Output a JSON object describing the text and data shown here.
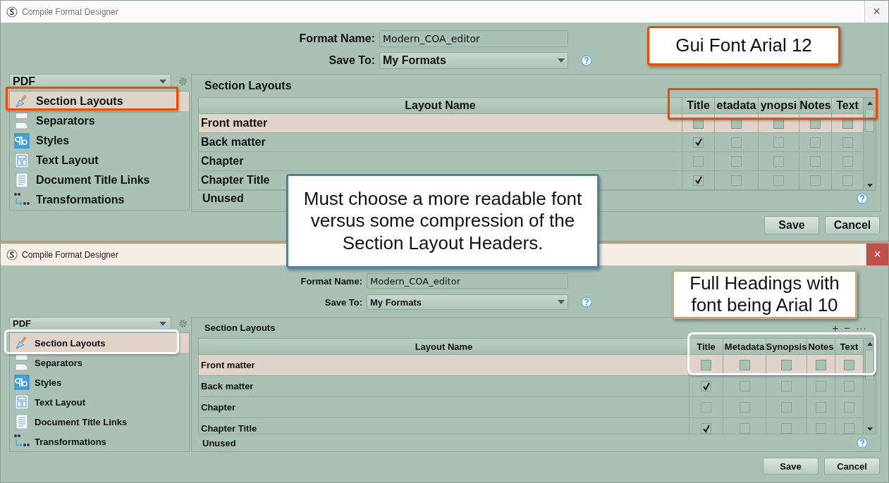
{
  "windows": [
    {
      "title": "Compile Format Designer",
      "active": false,
      "close": "×",
      "format_name_label": "Format Name:",
      "format_name": "Modern_COA_editor",
      "save_to_label": "Save To:",
      "save_to": "My Formats",
      "format_type": "PDF",
      "sidebar": {
        "items": [
          {
            "label": "Section Layouts",
            "selected": true
          },
          {
            "label": "Separators",
            "selected": false
          },
          {
            "label": "Styles",
            "selected": false
          },
          {
            "label": "Text Layout",
            "selected": false
          },
          {
            "label": "Document Title Links",
            "selected": false
          },
          {
            "label": "Transformations",
            "selected": false
          }
        ]
      },
      "panel_title": "Section Layouts",
      "table": {
        "columns": [
          "Layout Name",
          "Title",
          "etadata",
          "ynopsi",
          "Notes",
          "Text"
        ],
        "rows": [
          {
            "name": "Front matter",
            "selected": true,
            "checks": [
              false,
              false,
              false,
              false,
              false
            ]
          },
          {
            "name": "Back matter",
            "selected": false,
            "checks": [
              true,
              false,
              false,
              false,
              false
            ]
          },
          {
            "name": "Chapter",
            "selected": false,
            "checks": [
              false,
              false,
              false,
              false,
              false
            ]
          },
          {
            "name": "Chapter Title",
            "selected": false,
            "checks": [
              true,
              false,
              false,
              false,
              false
            ]
          }
        ]
      },
      "unused_label": "Unused",
      "buttons": [
        "Save",
        "Cancel"
      ]
    },
    {
      "title": "Compile Format Designer",
      "active": true,
      "close": "×",
      "format_name_label": "Format Name:",
      "format_name": "Modern_COA_editor",
      "save_to_label": "Save To:",
      "save_to": "My Formats",
      "format_type": "PDF",
      "sidebar": {
        "items": [
          {
            "label": "Section Layouts",
            "selected": true
          },
          {
            "label": "Separators",
            "selected": false
          },
          {
            "label": "Styles",
            "selected": false
          },
          {
            "label": "Text Layout",
            "selected": false
          },
          {
            "label": "Document Title Links",
            "selected": false
          },
          {
            "label": "Transformations",
            "selected": false
          }
        ]
      },
      "panel_title": "Section Layouts",
      "toolbar": [
        "+",
        "−",
        "···"
      ],
      "table": {
        "columns": [
          "Layout Name",
          "Title",
          "Metadata",
          "Synopsis",
          "Notes",
          "Text"
        ],
        "rows": [
          {
            "name": "Front matter",
            "selected": true,
            "checks": [
              false,
              false,
              false,
              false,
              false
            ]
          },
          {
            "name": "Back matter",
            "selected": false,
            "checks": [
              true,
              false,
              false,
              false,
              false
            ]
          },
          {
            "name": "Chapter",
            "selected": false,
            "checks": [
              false,
              false,
              false,
              false,
              false
            ]
          },
          {
            "name": "Chapter Title",
            "selected": false,
            "checks": [
              true,
              false,
              false,
              false,
              false
            ]
          }
        ]
      },
      "unused_label": "Unused",
      "buttons": [
        "Save",
        "Cancel"
      ]
    }
  ],
  "callouts": [
    {
      "text": "Gui Font Arial 12"
    },
    {
      "text": "Must choose a more readable font versus some compression of the Section Layout Headers."
    },
    {
      "text": "Full Headings with font being Arial 10"
    }
  ]
}
